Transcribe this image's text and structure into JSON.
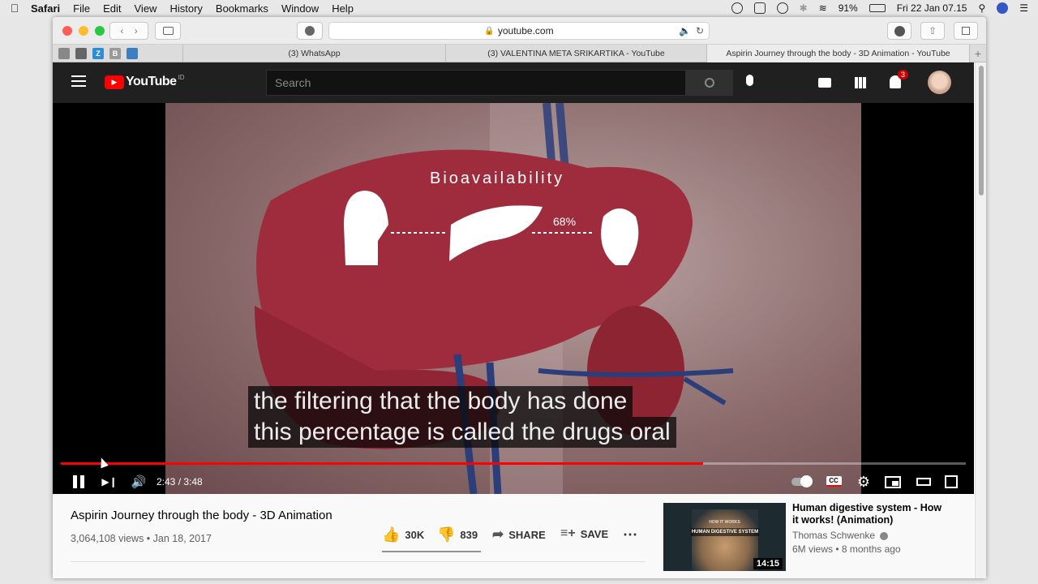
{
  "menubar": {
    "app_name": "Safari",
    "items": [
      "File",
      "Edit",
      "View",
      "History",
      "Bookmarks",
      "Window",
      "Help"
    ],
    "battery": "91%",
    "datetime": "Fri 22 Jan  07.15"
  },
  "browser": {
    "url": "youtube.com",
    "tabs": [
      "(3) WhatsApp",
      "(3) VALENTINA META SRIKARTIKA - YouTube",
      "Aspirin Journey through the body - 3D Animation - YouTube"
    ],
    "favorite_letters": [
      "Z",
      "B"
    ]
  },
  "youtube": {
    "logo_text": "YouTube",
    "region": "ID",
    "search_placeholder": "Search",
    "notification_count": "3"
  },
  "video": {
    "overlay_title": "Bioavailability",
    "overlay_percent": "68%",
    "captions": [
      "the filtering that the body has done",
      "this percentage is called the drugs oral"
    ],
    "time": "2:43 / 3:48",
    "progress_fraction": 0.71,
    "buffered_fraction": 0.71
  },
  "info": {
    "title": "Aspirin Journey through the body - 3D Animation",
    "meta": "3,064,108 views • Jan 18, 2017",
    "likes": "30K",
    "dislikes": "839",
    "share": "SHARE",
    "save": "SAVE"
  },
  "recommendation": {
    "title": "Human digestive system - How it works! (Animation)",
    "channel": "Thomas Schwenke",
    "meta": "6M views • 8 months ago",
    "duration": "14:15",
    "thumb_text_1": "HOW IT WORKS",
    "thumb_text_2": "HUMAN DIGESTIVE SYSTEM"
  },
  "colors": {
    "youtube_red": "#ff0000",
    "dark_bg": "#202020"
  }
}
